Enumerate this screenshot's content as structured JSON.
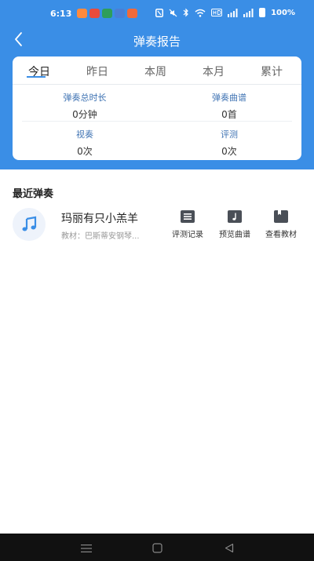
{
  "status_bar": {
    "time": "6:13",
    "battery": "100%"
  },
  "header": {
    "title": "弹奏报告"
  },
  "tabs": [
    {
      "label": "今日",
      "active": true
    },
    {
      "label": "昨日",
      "active": false
    },
    {
      "label": "本周",
      "active": false
    },
    {
      "label": "本月",
      "active": false
    },
    {
      "label": "累计",
      "active": false
    }
  ],
  "stats": {
    "play_duration": {
      "label": "弹奏总时长",
      "value": "0分钟"
    },
    "play_scores": {
      "label": "弹奏曲谱",
      "value": "0首"
    },
    "sight_reading": {
      "label": "视奏",
      "value": "0次"
    },
    "evaluation": {
      "label": "评测",
      "value": "0次"
    }
  },
  "recent": {
    "section_title": "最近弹奏",
    "items": [
      {
        "title": "玛丽有只小羔羊",
        "subtitle": "教材：巴斯蒂安钢琴...",
        "actions": [
          {
            "label": "评测记录",
            "icon": "list-icon"
          },
          {
            "label": "预览曲谱",
            "icon": "music-note-icon"
          },
          {
            "label": "查看教材",
            "icon": "book-icon"
          }
        ]
      }
    ]
  },
  "colors": {
    "primary": "#3a8ee6",
    "stat_label": "#3f73b3",
    "nav_bar": "#111111"
  }
}
